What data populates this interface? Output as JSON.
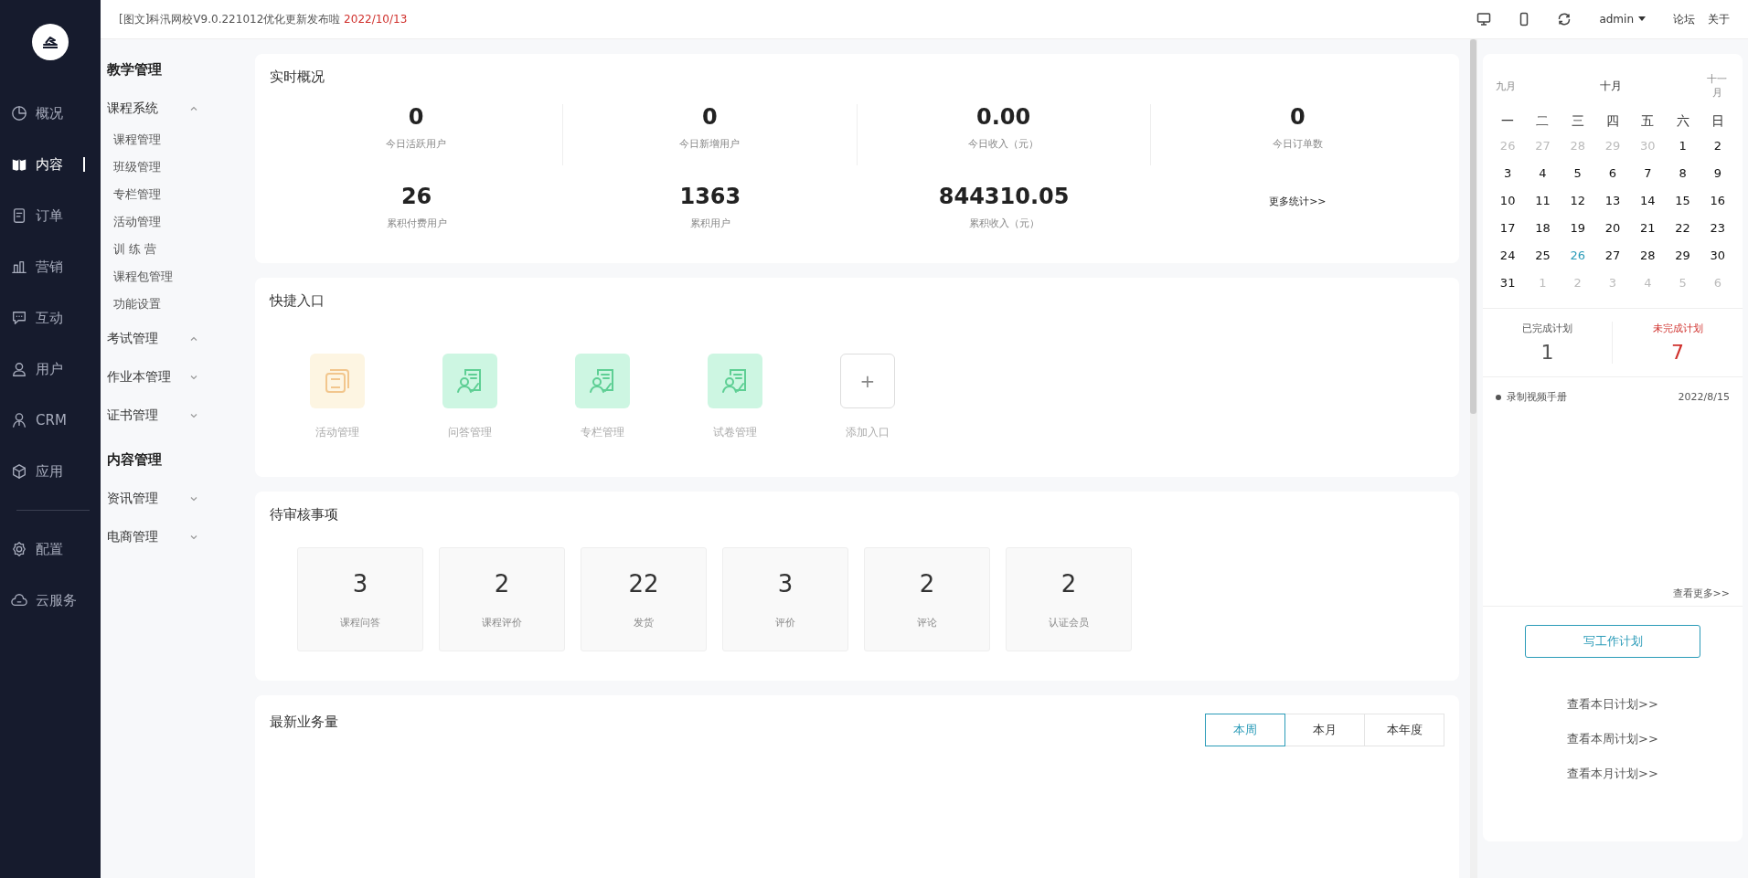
{
  "sidebar": {
    "items": [
      {
        "label": "概况",
        "selected": false
      },
      {
        "label": "内容",
        "selected": true
      },
      {
        "label": "订单",
        "selected": false
      },
      {
        "label": "营销",
        "selected": false
      },
      {
        "label": "互动",
        "selected": false
      },
      {
        "label": "用户",
        "selected": false
      },
      {
        "label": "CRM",
        "selected": false
      },
      {
        "label": "应用",
        "selected": false
      }
    ],
    "bottom_items": [
      {
        "label": "配置",
        "selected": false
      },
      {
        "label": "云服务",
        "selected": false
      }
    ]
  },
  "submenu": {
    "sections": [
      {
        "title": "教学管理",
        "items": [
          {
            "label": "课程系统",
            "expanded": true,
            "children": [
              {
                "label": "课程管理"
              },
              {
                "label": "班级管理"
              },
              {
                "label": "专栏管理"
              },
              {
                "label": "活动管理"
              },
              {
                "label": "训 练 营"
              },
              {
                "label": "课程包管理"
              },
              {
                "label": "功能设置"
              }
            ]
          },
          {
            "label": "考试管理",
            "expanded": true
          },
          {
            "label": "作业本管理",
            "expanded": false
          },
          {
            "label": "证书管理",
            "expanded": false
          }
        ]
      },
      {
        "title": "内容管理",
        "items": [
          {
            "label": "资讯管理",
            "expanded": false
          },
          {
            "label": "电商管理",
            "expanded": false
          }
        ]
      }
    ]
  },
  "topbar": {
    "notice": "[图文]科汛网校V9.0.221012优化更新发布啦",
    "notice_date": "2022/10/13",
    "user": "admin",
    "links": [
      "论坛",
      "关于"
    ]
  },
  "overview": {
    "title": "实时概况",
    "stats": [
      {
        "value": "0",
        "label": "今日活跃用户"
      },
      {
        "value": "0",
        "label": "今日新增用户"
      },
      {
        "value": "0.00",
        "label": "今日收入（元）"
      },
      {
        "value": "0",
        "label": "今日订单数"
      },
      {
        "value": "26",
        "label": "累积付费用户"
      },
      {
        "value": "1363",
        "label": "累积用户"
      },
      {
        "value": "844310.05",
        "label": "累积收入（元）"
      }
    ],
    "more_link": "更多统计>>"
  },
  "shortcuts": {
    "title": "快捷入口",
    "items": [
      {
        "label": "活动管理",
        "kind": "activity"
      },
      {
        "label": "问答管理",
        "kind": "doc"
      },
      {
        "label": "专栏管理",
        "kind": "doc"
      },
      {
        "label": "试卷管理",
        "kind": "doc"
      },
      {
        "label": "添加入口",
        "kind": "add",
        "symbol": "+"
      }
    ]
  },
  "pending": {
    "title": "待审核事项",
    "items": [
      {
        "value": "3",
        "label": "课程问答"
      },
      {
        "value": "2",
        "label": "课程评价"
      },
      {
        "value": "22",
        "label": "发货"
      },
      {
        "value": "3",
        "label": "评价"
      },
      {
        "value": "2",
        "label": "评论"
      },
      {
        "value": "2",
        "label": "认证会员"
      }
    ]
  },
  "business": {
    "title": "最新业务量",
    "tabs": [
      {
        "label": "本周",
        "selected": true
      },
      {
        "label": "本月",
        "selected": false
      },
      {
        "label": "本年度",
        "selected": false
      }
    ]
  },
  "calendar": {
    "prev_month": "九月",
    "month": "十月",
    "next_month": "十一月",
    "weekdays": [
      "一",
      "二",
      "三",
      "四",
      "五",
      "六",
      "日"
    ],
    "weeks": [
      [
        {
          "day": "26",
          "muted": true,
          "selected": false
        },
        {
          "day": "27",
          "muted": true,
          "selected": false
        },
        {
          "day": "28",
          "muted": true,
          "selected": false
        },
        {
          "day": "29",
          "muted": true,
          "selected": false
        },
        {
          "day": "30",
          "muted": true,
          "selected": false
        },
        {
          "day": "1",
          "muted": false,
          "selected": false
        },
        {
          "day": "2",
          "muted": false,
          "selected": false
        }
      ],
      [
        {
          "day": "3",
          "muted": false,
          "selected": false
        },
        {
          "day": "4",
          "muted": false,
          "selected": false
        },
        {
          "day": "5",
          "muted": false,
          "selected": false
        },
        {
          "day": "6",
          "muted": false,
          "selected": false
        },
        {
          "day": "7",
          "muted": false,
          "selected": false
        },
        {
          "day": "8",
          "muted": false,
          "selected": false
        },
        {
          "day": "9",
          "muted": false,
          "selected": false
        }
      ],
      [
        {
          "day": "10",
          "muted": false,
          "selected": false
        },
        {
          "day": "11",
          "muted": false,
          "selected": false
        },
        {
          "day": "12",
          "muted": false,
          "selected": false
        },
        {
          "day": "13",
          "muted": false,
          "selected": false
        },
        {
          "day": "14",
          "muted": false,
          "selected": false
        },
        {
          "day": "15",
          "muted": false,
          "selected": false
        },
        {
          "day": "16",
          "muted": false,
          "selected": false
        }
      ],
      [
        {
          "day": "17",
          "muted": false,
          "selected": false
        },
        {
          "day": "18",
          "muted": false,
          "selected": false
        },
        {
          "day": "19",
          "muted": false,
          "selected": false
        },
        {
          "day": "20",
          "muted": false,
          "selected": false
        },
        {
          "day": "21",
          "muted": false,
          "selected": false
        },
        {
          "day": "22",
          "muted": false,
          "selected": false
        },
        {
          "day": "23",
          "muted": false,
          "selected": false
        }
      ],
      [
        {
          "day": "24",
          "muted": false,
          "selected": false
        },
        {
          "day": "25",
          "muted": false,
          "selected": false
        },
        {
          "day": "26",
          "muted": false,
          "selected": true
        },
        {
          "day": "27",
          "muted": false,
          "selected": false
        },
        {
          "day": "28",
          "muted": false,
          "selected": false
        },
        {
          "day": "29",
          "muted": false,
          "selected": false
        },
        {
          "day": "30",
          "muted": false,
          "selected": false
        }
      ],
      [
        {
          "day": "31",
          "muted": false,
          "selected": false
        },
        {
          "day": "1",
          "muted": true,
          "selected": false
        },
        {
          "day": "2",
          "muted": true,
          "selected": false
        },
        {
          "day": "3",
          "muted": true,
          "selected": false
        },
        {
          "day": "4",
          "muted": true,
          "selected": false
        },
        {
          "day": "5",
          "muted": true,
          "selected": false
        },
        {
          "day": "6",
          "muted": true,
          "selected": false
        }
      ]
    ]
  },
  "plans": {
    "done_label": "已完成计划",
    "done_count": "1",
    "todo_label": "未完成计划",
    "todo_count": "7",
    "items": [
      {
        "title": "录制视频手册",
        "date": "2022/8/15"
      }
    ],
    "more_link": "查看更多>>",
    "write_button": "写工作计划",
    "links": [
      "查看本日计划>>",
      "查看本周计划>>",
      "查看本月计划>>"
    ]
  }
}
